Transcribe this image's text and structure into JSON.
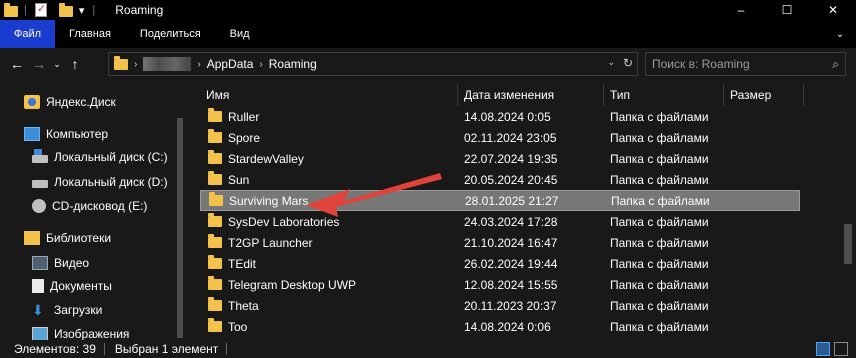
{
  "window": {
    "title": "Roaming"
  },
  "titlebar": {
    "minimize": "–",
    "maximize": "☐",
    "close": "✕"
  },
  "ribbon": {
    "tabs": [
      "Файл",
      "Главная",
      "Поделиться",
      "Вид"
    ]
  },
  "address": {
    "crumbs": [
      "AppData",
      "Roaming"
    ],
    "search_placeholder": "Поиск в: Roaming"
  },
  "nav_pane": {
    "items": [
      {
        "label": "Яндекс.Диск",
        "icon": "yandex-disk-icon"
      },
      {
        "label": "Компьютер",
        "icon": "computer-icon"
      },
      {
        "label": "Локальный диск (C:)",
        "icon": "system-drive-icon"
      },
      {
        "label": "Локальный диск (D:)",
        "icon": "drive-icon"
      },
      {
        "label": "CD-дисковод (E:)",
        "icon": "cd-drive-icon"
      },
      {
        "label": "Библиотеки",
        "icon": "libraries-icon"
      },
      {
        "label": "Видео",
        "icon": "video-icon"
      },
      {
        "label": "Документы",
        "icon": "documents-icon"
      },
      {
        "label": "Загрузки",
        "icon": "downloads-icon"
      },
      {
        "label": "Изображения",
        "icon": "images-icon"
      }
    ]
  },
  "columns": [
    "Имя",
    "Дата изменения",
    "Тип",
    "Размер"
  ],
  "files": [
    {
      "name": "Ruller",
      "date": "14.08.2024 0:05",
      "type": "Папка с файлами"
    },
    {
      "name": "Spore",
      "date": "02.11.2024 23:05",
      "type": "Папка с файлами"
    },
    {
      "name": "StardewValley",
      "date": "22.07.2024 19:35",
      "type": "Папка с файлами"
    },
    {
      "name": "Sun",
      "date": "20.05.2024 20:45",
      "type": "Папка с файлами"
    },
    {
      "name": "Surviving Mars",
      "date": "28.01.2025 21:27",
      "type": "Папка с файлами",
      "selected": true
    },
    {
      "name": "SysDev Laboratories",
      "date": "24.03.2024 17:28",
      "type": "Папка с файлами"
    },
    {
      "name": "T2GP Launcher",
      "date": "21.10.2024 16:47",
      "type": "Папка с файлами"
    },
    {
      "name": "TEdit",
      "date": "26.02.2024 19:44",
      "type": "Папка с файлами"
    },
    {
      "name": "Telegram Desktop UWP",
      "date": "12.08.2024 15:55",
      "type": "Папка с файлами"
    },
    {
      "name": "Theta",
      "date": "20.11.2023 20:37",
      "type": "Папка с файлами"
    },
    {
      "name": "Too",
      "date": "14.08.2024 0:06",
      "type": "Папка с файлами"
    }
  ],
  "status": {
    "items_count": "Элементов: 39",
    "selected": "Выбран 1 элемент"
  },
  "colors": {
    "accent": "#1a3ccf",
    "folder": "#f3c24c",
    "selection": "#777777",
    "arrow": "#e0433a"
  }
}
